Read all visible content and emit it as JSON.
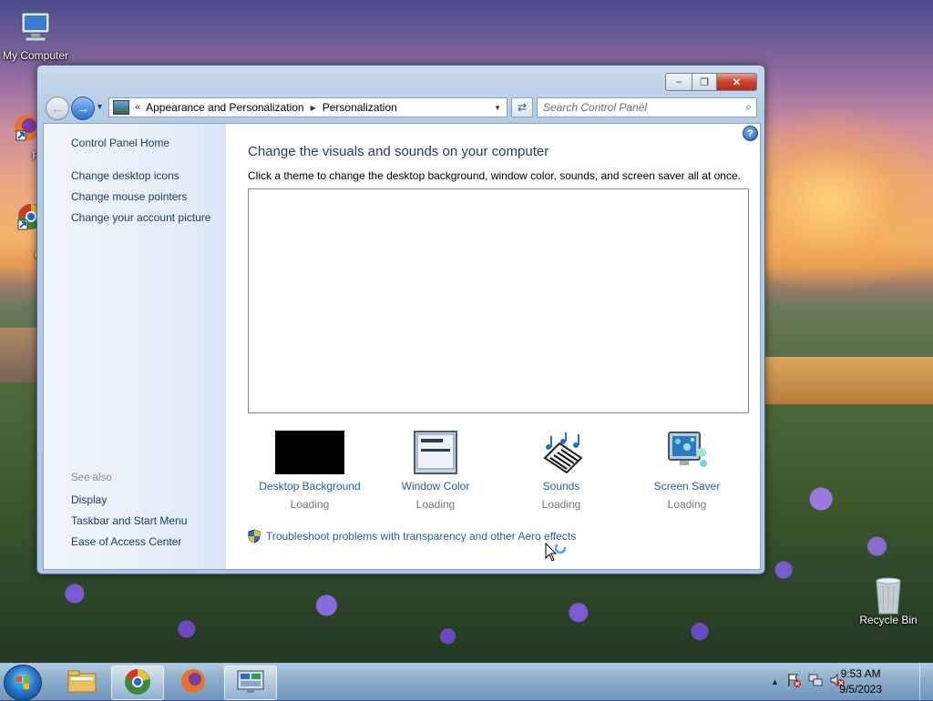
{
  "desktop": {
    "icons": [
      {
        "label": "My Computer"
      },
      {
        "label": "Fire"
      },
      {
        "label": "Goo Chro"
      },
      {
        "label": "Recycle Bin"
      }
    ]
  },
  "window": {
    "address": {
      "segments": [
        "Appearance and Personalization",
        "Personalization"
      ],
      "overflow": "«"
    },
    "search": {
      "placeholder": "Search Control Panel"
    },
    "left_pane": {
      "home": "Control Panel Home",
      "links": [
        "Change desktop icons",
        "Change mouse pointers",
        "Change your account picture"
      ],
      "see_also_label": "See also",
      "see_also": [
        "Display",
        "Taskbar and Start Menu",
        "Ease of Access Center"
      ]
    },
    "main": {
      "title": "Change the visuals and sounds on your computer",
      "subtitle": "Click a theme to change the desktop background, window color, sounds, and screen saver all at once.",
      "tiles": [
        {
          "label": "Desktop Background",
          "status": "Loading"
        },
        {
          "label": "Window Color",
          "status": "Loading"
        },
        {
          "label": "Sounds",
          "status": "Loading"
        },
        {
          "label": "Screen Saver",
          "status": "Loading"
        }
      ],
      "troubleshoot": "Troubleshoot problems with transparency and other Aero effects"
    }
  },
  "taskbar": {
    "clock": {
      "time": "9:53 AM",
      "date": "9/5/2023"
    }
  },
  "colors": {
    "link": "#1f5fa6",
    "heading": "#1e3a5f",
    "close_red": "#c8432c"
  }
}
